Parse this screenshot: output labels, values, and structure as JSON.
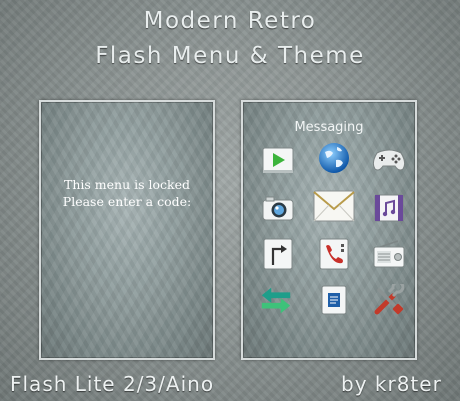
{
  "header": {
    "title_line1": "Modern Retro",
    "title_line2": "Flash Menu & Theme"
  },
  "lock_screen": {
    "line1": "This menu is locked",
    "line2": "Please enter a code:"
  },
  "menu": {
    "title": "Messaging",
    "icons": [
      "video-player-icon",
      "globe-icon",
      "gamepad-icon",
      "camera-icon",
      "envelope-icon",
      "music-icon",
      "navigation-icon",
      "phone-call-icon",
      "radio-icon",
      "sync-arrows-icon",
      "document-icon",
      "settings-tools-icon"
    ]
  },
  "footer": {
    "platform": "Flash Lite 2/3/Aino",
    "author": "by kr8ter"
  }
}
